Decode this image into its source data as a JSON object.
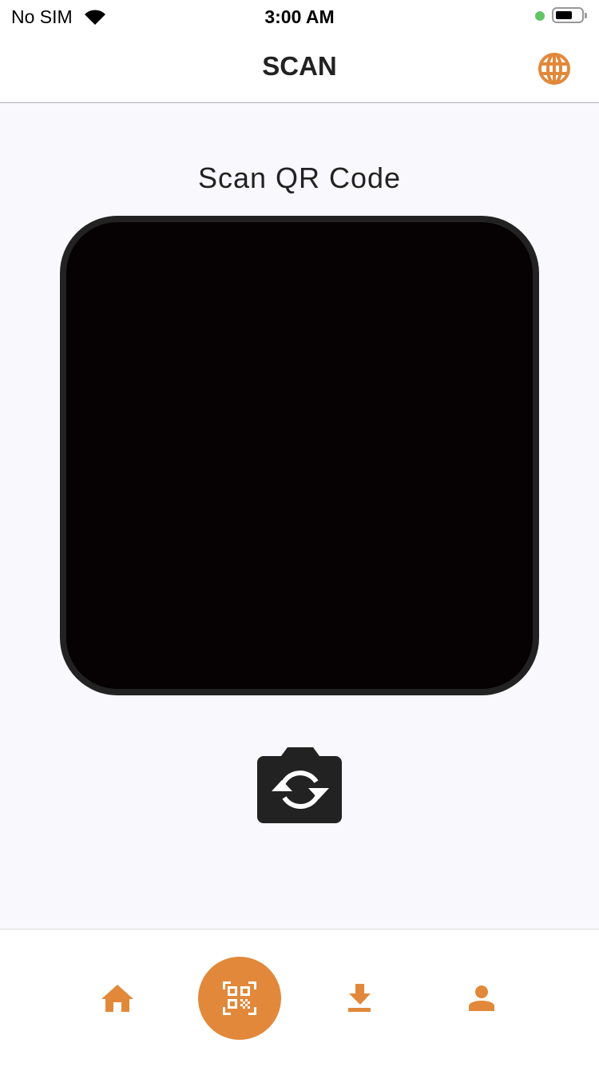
{
  "status_bar": {
    "carrier": "No SIM",
    "time": "3:00 AM",
    "battery_percent": 60
  },
  "header": {
    "title": "SCAN",
    "language_icon": "globe-icon"
  },
  "main": {
    "heading": "Scan QR Code",
    "switch_camera_icon": "camera-switch-icon"
  },
  "tab_bar": {
    "items": [
      {
        "icon": "home-icon"
      },
      {
        "icon": "qr-code-icon",
        "active": true
      },
      {
        "icon": "download-icon"
      },
      {
        "icon": "person-icon"
      }
    ]
  },
  "colors": {
    "accent": "#E2883A",
    "background": "#F8F8FD",
    "camera_frame": "#222222"
  }
}
